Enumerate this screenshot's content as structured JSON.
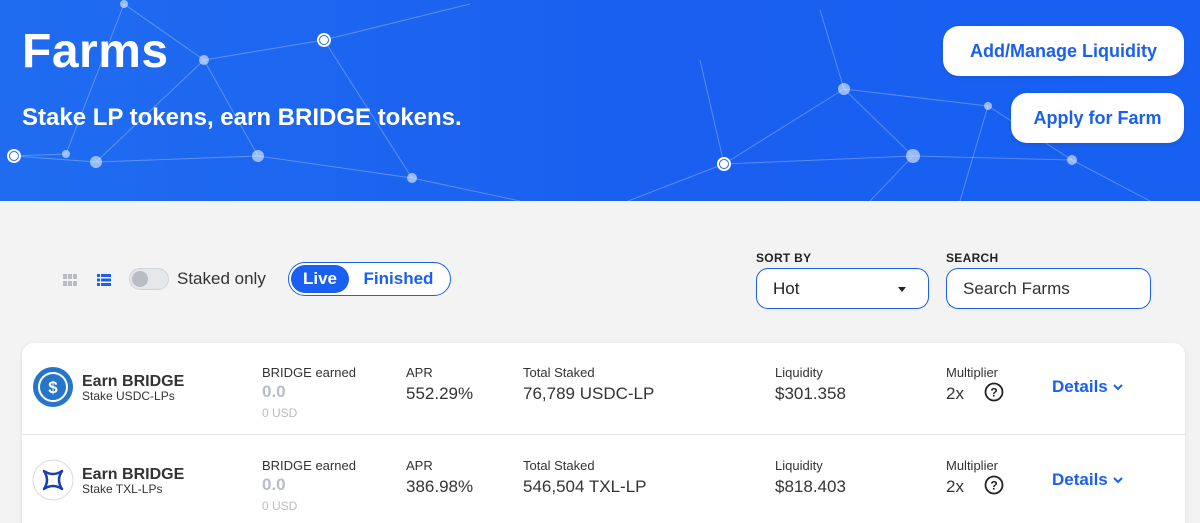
{
  "hero": {
    "title": "Farms",
    "subtitle": "Stake LP tokens, earn BRIDGE tokens.",
    "buttons": {
      "add_manage_liquidity": "Add/Manage Liquidity",
      "apply_for_farm": "Apply for Farm"
    }
  },
  "filters": {
    "staked_only_label": "Staked only",
    "staked_only_on": false,
    "tabs": {
      "live": "Live",
      "finished": "Finished"
    },
    "sort_label": "SORT BY",
    "sort_value": "Hot",
    "search_label": "SEARCH",
    "search_placeholder": "Search Farms"
  },
  "farms": [
    {
      "icon": "usdc-icon",
      "title": "Earn BRIDGE",
      "subtitle": "Stake USDC-LPs",
      "earned_label": "BRIDGE earned",
      "earned_value": "0.0",
      "earned_usd": "0 USD",
      "apr_label": "APR",
      "apr_value": "552.29%",
      "total_staked_label": "Total Staked",
      "total_staked_value": "76,789 USDC-LP",
      "liquidity_label": "Liquidity",
      "liquidity_value": "$301.358",
      "multiplier_label": "Multiplier",
      "multiplier_value": "2x",
      "details_label": "Details"
    },
    {
      "icon": "txl-icon",
      "title": "Earn BRIDGE",
      "subtitle": "Stake TXL-LPs",
      "earned_label": "BRIDGE earned",
      "earned_value": "0.0",
      "earned_usd": "0 USD",
      "apr_label": "APR",
      "apr_value": "386.98%",
      "total_staked_label": "Total Staked",
      "total_staked_value": "546,504 TXL-LP",
      "liquidity_label": "Liquidity",
      "liquidity_value": "$818.403",
      "multiplier_label": "Multiplier",
      "multiplier_value": "2x",
      "details_label": "Details"
    }
  ],
  "colors": {
    "brand_blue": "#1a5ff0",
    "muted": "#b8bcc4"
  }
}
